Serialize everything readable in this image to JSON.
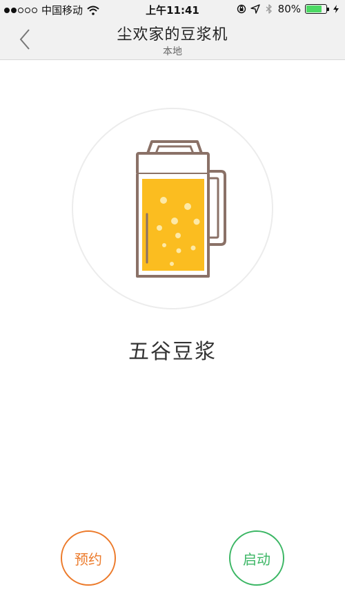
{
  "status_bar": {
    "signal": {
      "filled": 2,
      "total": 5
    },
    "carrier": "中国移动",
    "time": "上午11:41",
    "battery_percent_label": "80%",
    "battery_level": 0.8,
    "icons": [
      "wifi-icon",
      "orientation-lock-icon",
      "location-arrow-icon",
      "bluetooth-icon",
      "battery-icon",
      "charging-bolt-icon"
    ]
  },
  "nav": {
    "title": "尘欢家的豆浆机",
    "subtitle": "本地",
    "back_icon": "chevron-left-icon"
  },
  "main": {
    "illustration": "soymilk-mug-icon",
    "mode_name": "五谷豆浆"
  },
  "actions": {
    "schedule_label": "预约",
    "start_label": "启动"
  },
  "colors": {
    "schedule": "#ec7a2a",
    "start": "#3bb664",
    "liquid": "#fbbd20",
    "mug_outline": "#8a7167"
  }
}
